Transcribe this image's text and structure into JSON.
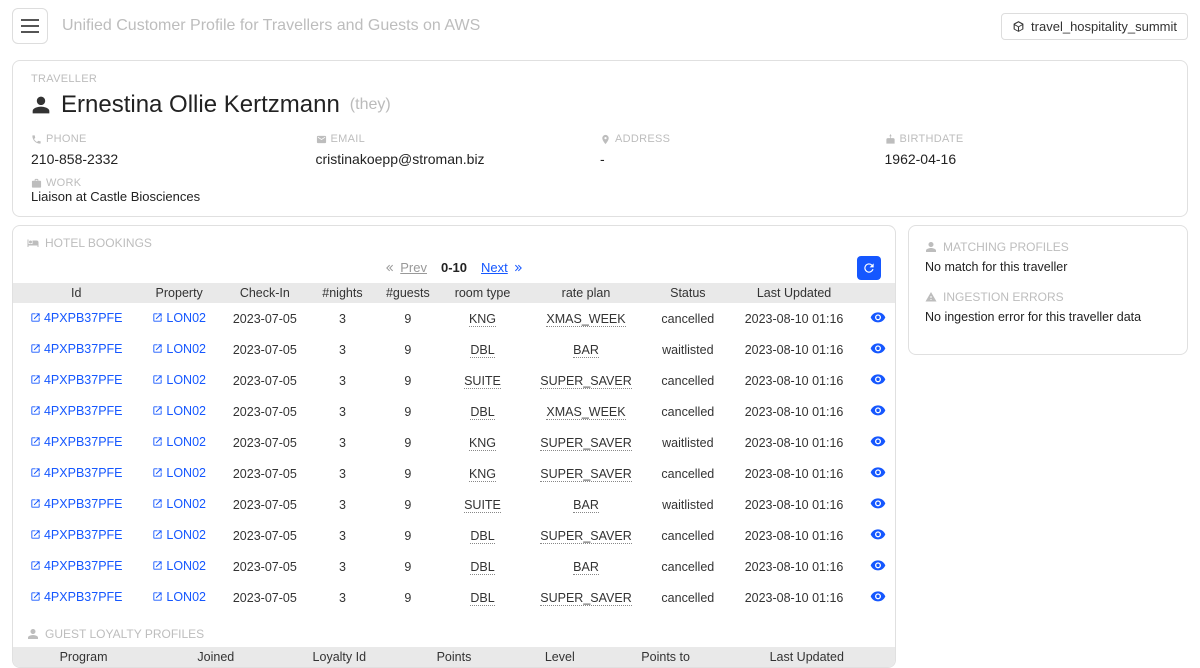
{
  "header": {
    "title": "Unified Customer Profile for Travellers and Guests on AWS",
    "env": "travel_hospitality_summit"
  },
  "traveller": {
    "label": "TRAVELLER",
    "name": "Ernestina Ollie Kertzmann",
    "pronoun": "(they)",
    "phone_label": "PHONE",
    "phone": "210-858-2332",
    "email_label": "EMAIL",
    "email": "cristinakoepp@stroman.biz",
    "address_label": "ADDRESS",
    "address": "-",
    "birthdate_label": "BIRTHDATE",
    "birthdate": "1962-04-16",
    "work_label": "WORK",
    "work": "Liaison at Castle Biosciences"
  },
  "bookings": {
    "label": "HOTEL BOOKINGS",
    "pager": {
      "prev": "Prev",
      "range": "0-10",
      "next": "Next"
    },
    "columns": [
      "Id",
      "Property",
      "Check-In",
      "#nights",
      "#guests",
      "room type",
      "rate plan",
      "Status",
      "Last Updated",
      ""
    ],
    "rows": [
      {
        "id": "4PXPB37PFE",
        "property": "LON02",
        "checkin": "2023-07-05",
        "nights": "3",
        "guests": "9",
        "room": "KNG",
        "rate": "XMAS_WEEK",
        "status": "cancelled",
        "updated": "2023-08-10 01:16"
      },
      {
        "id": "4PXPB37PFE",
        "property": "LON02",
        "checkin": "2023-07-05",
        "nights": "3",
        "guests": "9",
        "room": "DBL",
        "rate": "BAR",
        "status": "waitlisted",
        "updated": "2023-08-10 01:16"
      },
      {
        "id": "4PXPB37PFE",
        "property": "LON02",
        "checkin": "2023-07-05",
        "nights": "3",
        "guests": "9",
        "room": "SUITE",
        "rate": "SUPER_SAVER",
        "status": "cancelled",
        "updated": "2023-08-10 01:16"
      },
      {
        "id": "4PXPB37PFE",
        "property": "LON02",
        "checkin": "2023-07-05",
        "nights": "3",
        "guests": "9",
        "room": "DBL",
        "rate": "XMAS_WEEK",
        "status": "cancelled",
        "updated": "2023-08-10 01:16"
      },
      {
        "id": "4PXPB37PFE",
        "property": "LON02",
        "checkin": "2023-07-05",
        "nights": "3",
        "guests": "9",
        "room": "KNG",
        "rate": "SUPER_SAVER",
        "status": "waitlisted",
        "updated": "2023-08-10 01:16"
      },
      {
        "id": "4PXPB37PFE",
        "property": "LON02",
        "checkin": "2023-07-05",
        "nights": "3",
        "guests": "9",
        "room": "KNG",
        "rate": "SUPER_SAVER",
        "status": "cancelled",
        "updated": "2023-08-10 01:16"
      },
      {
        "id": "4PXPB37PFE",
        "property": "LON02",
        "checkin": "2023-07-05",
        "nights": "3",
        "guests": "9",
        "room": "SUITE",
        "rate": "BAR",
        "status": "waitlisted",
        "updated": "2023-08-10 01:16"
      },
      {
        "id": "4PXPB37PFE",
        "property": "LON02",
        "checkin": "2023-07-05",
        "nights": "3",
        "guests": "9",
        "room": "DBL",
        "rate": "SUPER_SAVER",
        "status": "cancelled",
        "updated": "2023-08-10 01:16"
      },
      {
        "id": "4PXPB37PFE",
        "property": "LON02",
        "checkin": "2023-07-05",
        "nights": "3",
        "guests": "9",
        "room": "DBL",
        "rate": "BAR",
        "status": "cancelled",
        "updated": "2023-08-10 01:16"
      },
      {
        "id": "4PXPB37PFE",
        "property": "LON02",
        "checkin": "2023-07-05",
        "nights": "3",
        "guests": "9",
        "room": "DBL",
        "rate": "SUPER_SAVER",
        "status": "cancelled",
        "updated": "2023-08-10 01:16"
      }
    ]
  },
  "loyalty": {
    "label": "GUEST LOYALTY PROFILES",
    "columns": [
      "Program",
      "Joined",
      "Loyalty Id",
      "Points",
      "Level",
      "Points to",
      "Last Updated"
    ]
  },
  "side": {
    "matching_label": "MATCHING PROFILES",
    "matching_text": "No match for this traveller",
    "ingestion_label": "INGESTION ERRORS",
    "ingestion_text": "No ingestion error for this traveller data"
  }
}
